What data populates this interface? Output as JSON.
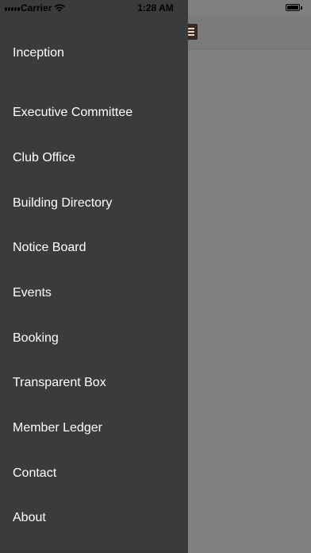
{
  "status_bar": {
    "carrier": "Carrier",
    "time": "1:28 AM",
    "signal_icon": "signal-dots-icon",
    "wifi_icon": "wifi-icon",
    "battery_icon": "battery-icon",
    "battery_level": 1.0
  },
  "colors": {
    "drawer_background": "#3a3b3d",
    "menu_text": "#ffffff",
    "overlay": "#808080"
  },
  "drawer": {
    "items": [
      {
        "label": "Inception"
      },
      {
        "label": "Executive Committee"
      },
      {
        "label": "Club Office"
      },
      {
        "label": "Building Directory"
      },
      {
        "label": "Notice Board"
      },
      {
        "label": "Events"
      },
      {
        "label": "Booking"
      },
      {
        "label": "Transparent Box"
      },
      {
        "label": "Member Ledger"
      },
      {
        "label": "Contact"
      },
      {
        "label": "About"
      }
    ]
  },
  "app": {
    "menu_toggle_icon": "hamburger-menu-icon"
  }
}
